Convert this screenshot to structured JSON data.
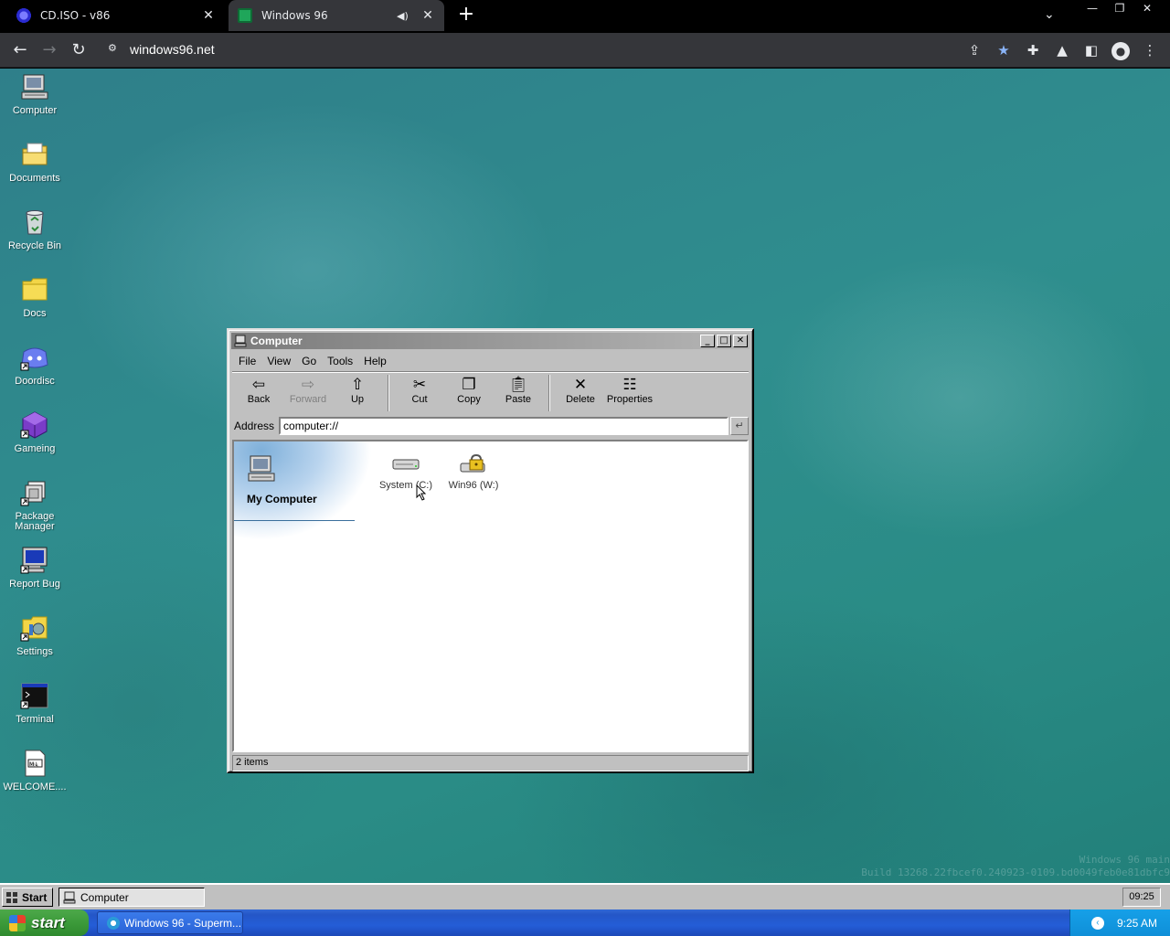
{
  "browser": {
    "tabs": [
      {
        "title": "CD.ISO - v86",
        "favicon": "v86-icon"
      },
      {
        "title": "Windows 96",
        "favicon": "windows96-icon",
        "audio": true
      }
    ],
    "url": "windows96.net"
  },
  "desktop": {
    "icons": [
      {
        "label": "Computer",
        "icon": "computer-icon"
      },
      {
        "label": "Documents",
        "icon": "folder-documents-icon"
      },
      {
        "label": "Recycle Bin",
        "icon": "recycle-bin-icon"
      },
      {
        "label": "Docs",
        "icon": "folder-icon"
      },
      {
        "label": "Doordisc",
        "icon": "discord-icon"
      },
      {
        "label": "Gameing",
        "icon": "cube-icon"
      },
      {
        "label": "Package Manager",
        "icon": "package-icon"
      },
      {
        "label": "Report Bug",
        "icon": "monitor-icon"
      },
      {
        "label": "Settings",
        "icon": "settings-icon"
      },
      {
        "label": "Terminal",
        "icon": "terminal-icon"
      },
      {
        "label": "WELCOME....",
        "icon": "markdown-file-icon"
      }
    ],
    "watermark_line1": "Windows 96 main",
    "watermark_line2": "Build 13268.22fbcef0.240923-0109.bd0049feb0e81dbfc9"
  },
  "window": {
    "title": "Computer",
    "menu": [
      "File",
      "View",
      "Go",
      "Tools",
      "Help"
    ],
    "toolbar": {
      "back": "Back",
      "forward": "Forward",
      "up": "Up",
      "cut": "Cut",
      "copy": "Copy",
      "paste": "Paste",
      "delete": "Delete",
      "properties": "Properties"
    },
    "address_label": "Address",
    "address_value": "computer://",
    "sidebar_title": "My Computer",
    "items": [
      {
        "label": "System (C:)",
        "icon": "hard-drive-icon"
      },
      {
        "label": "Win96 (W:)",
        "icon": "locked-drive-icon"
      }
    ],
    "status": "2 items"
  },
  "taskbar96": {
    "start": "Start",
    "task": "Computer",
    "clock": "09:25"
  },
  "xp_taskbar": {
    "start": "start",
    "task": "Windows 96 - Superm...",
    "clock": "9:25 AM"
  }
}
